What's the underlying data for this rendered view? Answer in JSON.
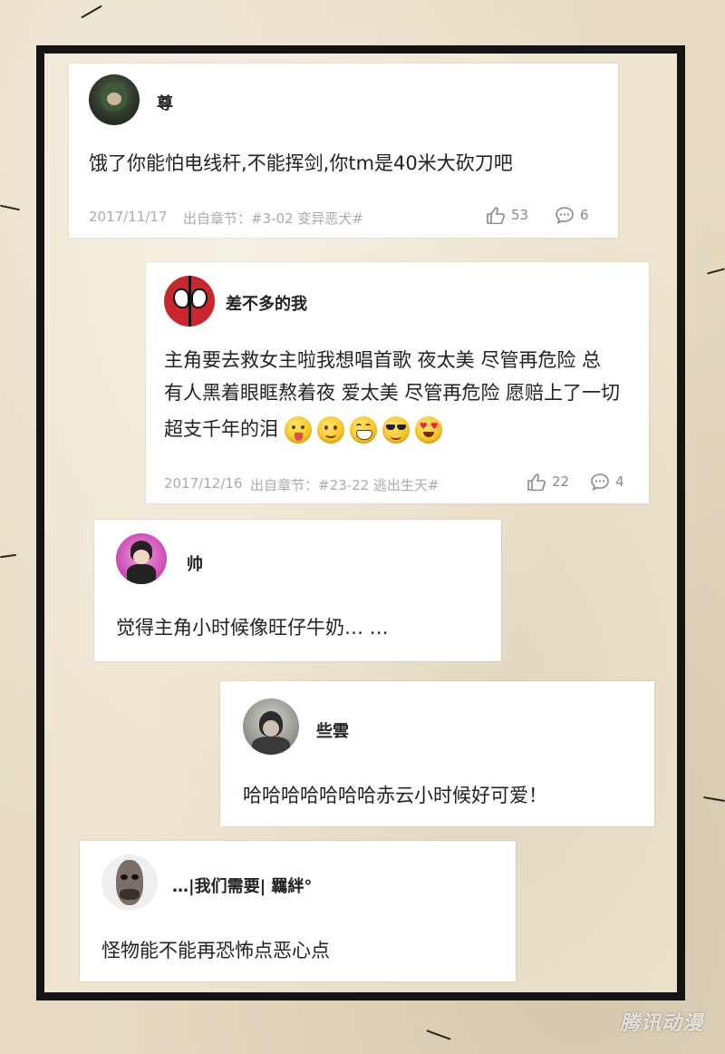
{
  "comments": [
    {
      "username": "尊",
      "text": "饿了你能怕电线杆,不能挥剑,你tm是40米大砍刀吧",
      "date": "2017/11/17",
      "source": "出自章节：#3-02 变异恶犬#",
      "likes": "53",
      "replies": "6"
    },
    {
      "username": "差不多的我",
      "text_lines": [
        "主角要去救女主啦我想唱首歌  夜太美 尽管再危险 总",
        "有人黑着眼眶熬着夜 爱太美 尽管再危险 愿赔上了一切",
        "超支千年的泪"
      ],
      "emojis": [
        "tongue-emoji",
        "smile-emoji",
        "grin-emoji",
        "sunglasses-emoji",
        "heart-eyes-emoji"
      ],
      "date": "2017/12/16",
      "source": "出自章节：#23-22 逃出生天#",
      "likes": "22",
      "replies": "4"
    },
    {
      "username": "帅",
      "text": "觉得主角小时候像旺仔牛奶… …"
    },
    {
      "username": "些雲",
      "text": "哈哈哈哈哈哈哈赤云小时候好可爱！"
    },
    {
      "username": "…|我们需要| 羈絆°",
      "text": "怪物能不能再恐怖点恶心点"
    }
  ],
  "watermark": "腾讯动漫"
}
